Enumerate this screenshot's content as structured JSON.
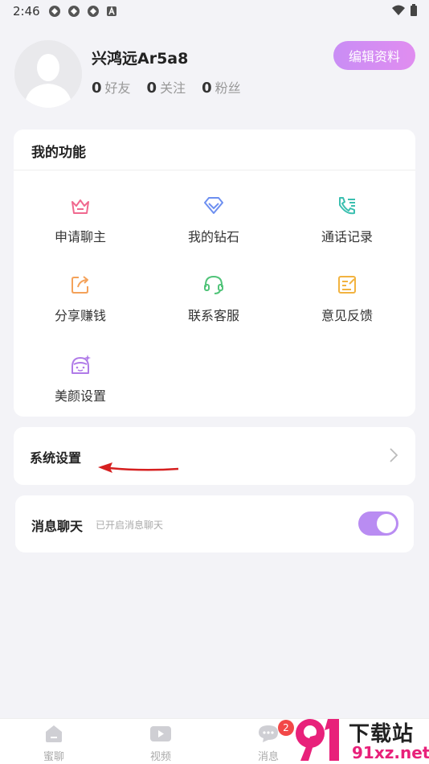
{
  "status_bar": {
    "time": "2:46"
  },
  "profile": {
    "username": "兴鸿远Ar5a8",
    "edit_label": "编辑资料",
    "stats": [
      {
        "num": "0",
        "label": "好友"
      },
      {
        "num": "0",
        "label": "关注"
      },
      {
        "num": "0",
        "label": "粉丝"
      }
    ]
  },
  "functions": {
    "title": "我的功能",
    "items": [
      {
        "label": "申请聊主",
        "icon": "crown-icon",
        "color": "#f0698f"
      },
      {
        "label": "我的钻石",
        "icon": "diamond-icon",
        "color": "#6d8ff0"
      },
      {
        "label": "通话记录",
        "icon": "phone-list-icon",
        "color": "#3bbfb0"
      },
      {
        "label": "分享赚钱",
        "icon": "share-icon",
        "color": "#f4a25a"
      },
      {
        "label": "联系客服",
        "icon": "headset-icon",
        "color": "#52c47a"
      },
      {
        "label": "意见反馈",
        "icon": "feedback-icon",
        "color": "#f2b340"
      },
      {
        "label": "美颜设置",
        "icon": "beauty-face-icon",
        "color": "#b07be8"
      }
    ]
  },
  "settings": {
    "label": "系统设置"
  },
  "chat": {
    "label": "消息聊天",
    "sub": "已开启消息聊天",
    "enabled": true
  },
  "bottom_nav": {
    "items": [
      {
        "label": "蜜聊",
        "icon": "home-icon"
      },
      {
        "label": "视频",
        "icon": "video-icon"
      },
      {
        "label": "消息",
        "icon": "message-icon"
      }
    ],
    "badge": "2"
  },
  "watermark": {
    "text": "下载站",
    "url": "91xz.net"
  }
}
